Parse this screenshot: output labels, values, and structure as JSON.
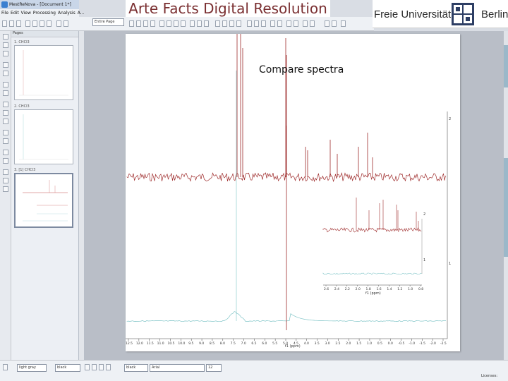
{
  "window": {
    "title": "MestReNova - [Document 1*]"
  },
  "menu": {
    "items": [
      "File",
      "Edit",
      "View",
      "Processing",
      "Analysis",
      "A..."
    ]
  },
  "toolbar": {
    "page_dropdown_value": "Entire Page"
  },
  "pages_panel": {
    "header": "Pages",
    "pages": [
      {
        "label": "1. CHCl3"
      },
      {
        "label": "2. CHCl3"
      },
      {
        "label": "3. [1] CHCl3"
      }
    ],
    "selected_index": 2
  },
  "spectrum": {
    "title_text": "Compare spectra",
    "main_axis_label": "f1 (ppm)",
    "main_axis_ticks": [
      "12.5",
      "12.0",
      "11.5",
      "11.0",
      "10.5",
      "10.0",
      "9.5",
      "9.0",
      "8.5",
      "8.0",
      "7.5",
      "7.0",
      "6.5",
      "6.0",
      "5.5",
      "5.0",
      "4.5",
      "4.0",
      "3.5",
      "3.0",
      "2.5",
      "2.0",
      "1.5",
      "1.0",
      "0.5",
      "0.0",
      "-0.5",
      "-1.0",
      "-1.5",
      "-2.0",
      "-2.5"
    ],
    "inset_axis_label": "f1 (ppm)",
    "inset_axis_ticks": [
      "2.6",
      "2.4",
      "2.2",
      "2.0",
      "1.8",
      "1.6",
      "1.4",
      "1.2",
      "1.0",
      "0.8"
    ],
    "trace_labels": [
      "2",
      "1"
    ],
    "inset_trace_labels": [
      "2",
      "1"
    ],
    "colors": {
      "spectrum_red": "#9e2b2b",
      "spectrum_teal": "#7fc4c7"
    }
  },
  "statusbar": {
    "line_color": "light gray",
    "color_field": "black",
    "font_color": "black",
    "font_name": "Arial",
    "font_size": "12",
    "licenses": "Licenses:"
  },
  "overlay": {
    "slide_title": "Arte Facts Digital Resolution",
    "logo_left": "Freie Universität",
    "logo_right": "Berlin"
  }
}
